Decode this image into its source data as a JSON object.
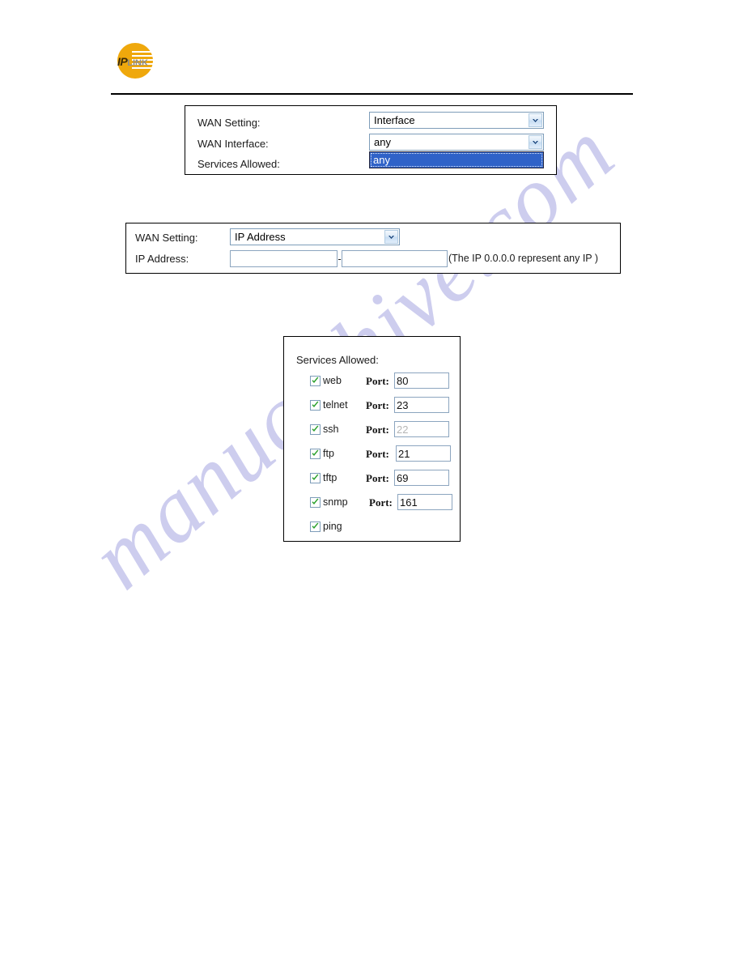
{
  "header": {
    "logo": {
      "icon": "iplink-logo-icon",
      "primary_text": "IP",
      "secondary_text": "LINK"
    }
  },
  "watermark": {
    "text": "manualshive.com",
    "color": "#cbcbee"
  },
  "panel_interface": {
    "rows": {
      "wan_setting_label": "WAN Setting:",
      "wan_interface_label": "WAN Interface:",
      "services_allowed_label": "Services Allowed:"
    },
    "wan_setting_select": {
      "value": "Interface",
      "icon": "chevron-down-icon"
    },
    "wan_interface_select": {
      "value": "any",
      "icon": "chevron-down-icon"
    },
    "dropdown_open": {
      "selected_option": "any",
      "highlight_color": "#2f62c8"
    }
  },
  "panel_ipaddress": {
    "wan_setting_label": "WAN Setting:",
    "wan_setting_select": {
      "value": "IP Address",
      "icon": "chevron-down-icon"
    },
    "ip_address_label": "IP Address:",
    "ip_start": {
      "value": "",
      "placeholder": ""
    },
    "ip_separator": "-",
    "ip_end": {
      "value": "",
      "placeholder": ""
    },
    "note": "(The IP 0.0.0.0 represent any IP )"
  },
  "panel_services": {
    "title": "Services Allowed:",
    "port_label": "Port:",
    "items": [
      {
        "name": "web",
        "checked": true,
        "has_port": true,
        "port": "80",
        "port_disabled": false
      },
      {
        "name": "telnet",
        "checked": true,
        "has_port": true,
        "port": "23",
        "port_disabled": false
      },
      {
        "name": "ssh",
        "checked": true,
        "has_port": true,
        "port": "22",
        "port_disabled": true
      },
      {
        "name": "ftp",
        "checked": true,
        "has_port": true,
        "port": "21",
        "port_disabled": false
      },
      {
        "name": "tftp",
        "checked": true,
        "has_port": true,
        "port": "69",
        "port_disabled": false
      },
      {
        "name": "snmp",
        "checked": true,
        "has_port": true,
        "port": "161",
        "port_disabled": false
      },
      {
        "name": "ping",
        "checked": true,
        "has_port": false,
        "port": "",
        "port_disabled": false
      }
    ]
  }
}
